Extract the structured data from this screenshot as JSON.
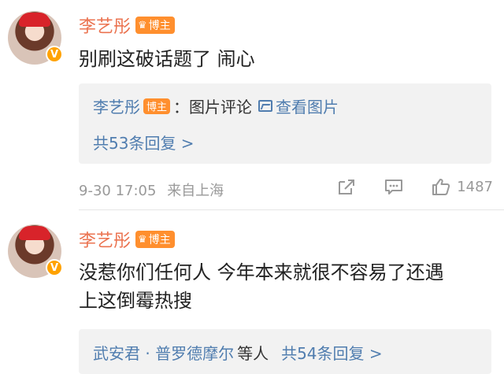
{
  "comments": [
    {
      "author": "李艺彤",
      "badge": "博主",
      "text": "别刷这破话题了 闹心",
      "reply": {
        "author": "李艺彤",
        "badge": "博主",
        "content": "：图片评论",
        "view_image": "查看图片",
        "count_text": "共53条回复 >"
      },
      "time": "9-30 17:05",
      "source": "来自上海",
      "likes": "1487"
    },
    {
      "author": "李艺彤",
      "badge": "博主",
      "text_line1": "没惹你们任何人 今年本来就很不容易了还遇",
      "text_line2": "上这倒霉热搜",
      "reply": {
        "users": "武安君 · 普罗德摩尔",
        "suffix": "等人",
        "count_text": "共54条回复 >"
      }
    }
  ],
  "icons": {
    "verified": "verified-v-icon",
    "crown": "crown-icon",
    "share": "share-icon",
    "comment": "comment-icon",
    "like": "thumb-up-icon",
    "image": "image-icon"
  },
  "colors": {
    "name": "#eb7350",
    "link": "#507daf",
    "badge": "#ff8f2e",
    "verified": "#ffa200"
  }
}
